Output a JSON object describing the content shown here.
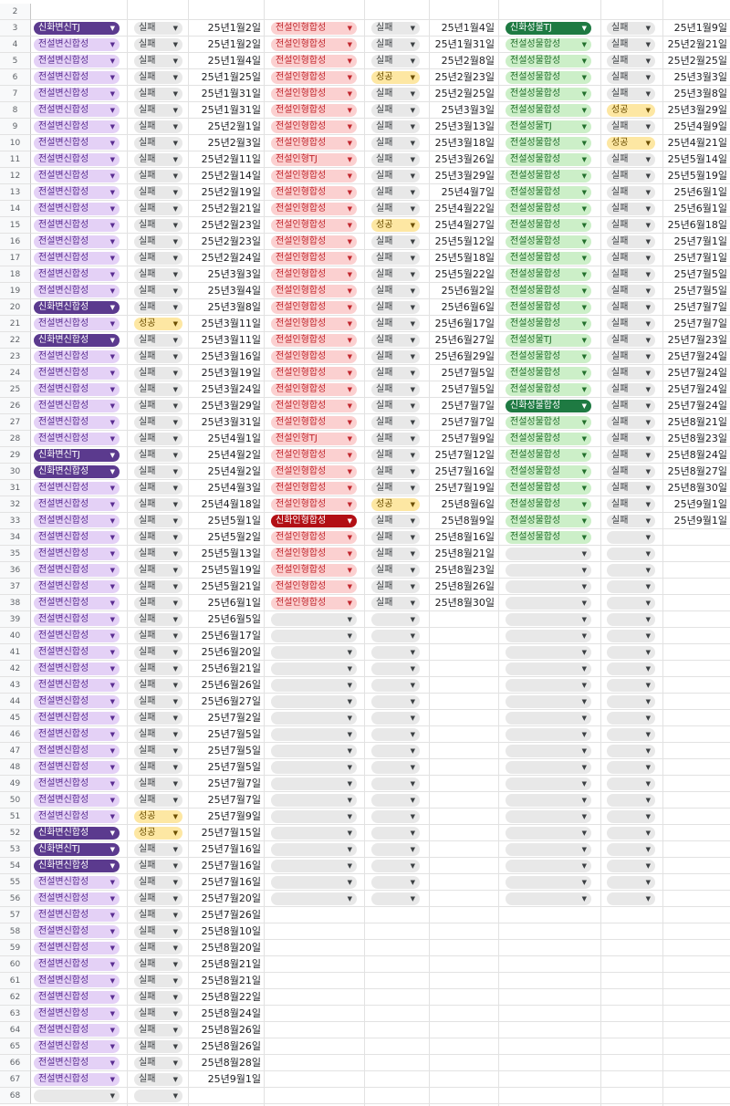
{
  "sheet": {
    "first_row": 2,
    "colors": {
      "purple-light": "#e4d1f6",
      "purple-dark": "#5b3a8e",
      "gray": "#e8e8e8",
      "yellow": "#fde7a3",
      "pink": "#fbd0d0",
      "red-dark": "#b20f15",
      "green-light": "#ccefc8",
      "green-dark": "#1e7a42"
    },
    "col_a": [
      null,
      "신화변신TJ",
      "전설변신합성",
      "전설변신합성",
      "전설변신합성",
      "전설변신합성",
      "전설변신합성",
      "전설변신합성",
      "전설변신합성",
      "전설변신합성",
      "전설변신합성",
      "전설변신합성",
      "전설변신합성",
      "전설변신합성",
      "전설변신합성",
      "전설변신합성",
      "전설변신합성",
      "전설변신합성",
      "신화변신합성",
      "전설변신합성",
      "신화변신합성",
      "전설변신합성",
      "전설변신합성",
      "전설변신합성",
      "전설변신합성",
      "전설변신합성",
      "전설변신합성",
      "신화변신TJ",
      "신화변신합성",
      "전설변신합성",
      "전설변신합성",
      "전설변신합성",
      "전설변신합성",
      "전설변신합성",
      "전설변신합성",
      "전설변신합성",
      "전설변신합성",
      "전설변신합성",
      "전설변신합성",
      "전설변신합성",
      "전설변신합성",
      "전설변신합성",
      "전설변신합성",
      "전설변신합성",
      "전설변신합성",
      "전설변신합성",
      "전설변신합성",
      "전설변신합성",
      "전설변신합성",
      "전설변신합성",
      "신화변신합성",
      "신화변신TJ",
      "신화변신합성",
      "전설변신합성",
      "전설변신합성",
      "전설변신합성",
      "전설변신합성",
      "전설변신합성",
      "전설변신합성",
      "전설변신합성",
      "전설변신합성",
      "전설변신합성",
      "전설변신합성",
      "전설변신합성",
      "전설변신합성",
      "전설변신합성",
      ""
    ],
    "col_b": [
      null,
      "실패",
      "실패",
      "실패",
      "실패",
      "실패",
      "실패",
      "실패",
      "실패",
      "실패",
      "실패",
      "실패",
      "실패",
      "실패",
      "실패",
      "실패",
      "실패",
      "실패",
      "실패",
      "성공",
      "실패",
      "실패",
      "실패",
      "실패",
      "실패",
      "실패",
      "실패",
      "실패",
      "실패",
      "실패",
      "실패",
      "실패",
      "실패",
      "실패",
      "실패",
      "실패",
      "실패",
      "실패",
      "실패",
      "실패",
      "실패",
      "실패",
      "실패",
      "실패",
      "실패",
      "실패",
      "실패",
      "실패",
      "실패",
      "성공",
      "성공",
      "실패",
      "실패",
      "실패",
      "실패",
      "실패",
      "실패",
      "실패",
      "실패",
      "실패",
      "실패",
      "실패",
      "실패",
      "실패",
      "실패",
      "실패",
      ""
    ],
    "col_c": [
      null,
      "25년1월2일",
      "25년1월2일",
      "25년1월4일",
      "25년1월25일",
      "25년1월31일",
      "25년1월31일",
      "25년2월1일",
      "25년2월3일",
      "25년2월11일",
      "25년2월14일",
      "25년2월19일",
      "25년2월21일",
      "25년2월23일",
      "25년2월23일",
      "25년2월24일",
      "25년3월3일",
      "25년3월4일",
      "25년3월8일",
      "25년3월11일",
      "25년3월11일",
      "25년3월16일",
      "25년3월19일",
      "25년3월24일",
      "25년3월29일",
      "25년3월31일",
      "25년4월1일",
      "25년4월2일",
      "25년4월2일",
      "25년4월3일",
      "25년4월18일",
      "25년5월1일",
      "25년5월2일",
      "25년5월13일",
      "25년5월19일",
      "25년5월21일",
      "25년6월1일",
      "25년6월5일",
      "25년6월17일",
      "25년6월20일",
      "25년6월21일",
      "25년6월26일",
      "25년6월27일",
      "25년7월2일",
      "25년7월5일",
      "25년7월5일",
      "25년7월5일",
      "25년7월7일",
      "25년7월7일",
      "25년7월9일",
      "25년7월15일",
      "25년7월16일",
      "25년7월16일",
      "25년7월16일",
      "25년7월20일",
      "25년7월26일",
      "25년8월10일",
      "25년8월20일",
      "25년8월21일",
      "25년8월21일",
      "25년8월22일",
      "25년8월24일",
      "25년8월26일",
      "25년8월26일",
      "25년8월28일",
      "25년9월1일",
      null
    ],
    "col_d": [
      null,
      "전설인형합성",
      "전설인형합성",
      "전설인형합성",
      "전설인형합성",
      "전설인형합성",
      "전설인형합성",
      "전설인형합성",
      "전설인형합성",
      "전설인형TJ",
      "전설인형합성",
      "전설인형합성",
      "전설인형합성",
      "전설인형합성",
      "전설인형합성",
      "전설인형합성",
      "전설인형합성",
      "전설인형합성",
      "전설인형합성",
      "전설인형합성",
      "전설인형합성",
      "전설인형합성",
      "전설인형합성",
      "전설인형합성",
      "전설인형합성",
      "전설인형합성",
      "전설인형TJ",
      "전설인형합성",
      "전설인형합성",
      "전설인형합성",
      "전설인형합성",
      "신화인형합성",
      "전설인형합성",
      "전설인형합성",
      "전설인형합성",
      "전설인형합성",
      "전설인형합성",
      "",
      "",
      "",
      "",
      "",
      "",
      "",
      "",
      "",
      "",
      "",
      "",
      "",
      "",
      "",
      "",
      "",
      "",
      null,
      null,
      null,
      null,
      null,
      null,
      null,
      null,
      null,
      null,
      null,
      null
    ],
    "col_e": [
      null,
      "실패",
      "실패",
      "실패",
      "성공",
      "실패",
      "실패",
      "실패",
      "실패",
      "실패",
      "실패",
      "실패",
      "실패",
      "성공",
      "실패",
      "실패",
      "실패",
      "실패",
      "실패",
      "실패",
      "실패",
      "실패",
      "실패",
      "실패",
      "실패",
      "실패",
      "실패",
      "실패",
      "실패",
      "실패",
      "성공",
      "실패",
      "실패",
      "실패",
      "실패",
      "실패",
      "실패",
      "",
      "",
      "",
      "",
      "",
      "",
      "",
      "",
      "",
      "",
      "",
      "",
      "",
      "",
      "",
      "",
      "",
      "",
      null,
      null,
      null,
      null,
      null,
      null,
      null,
      null,
      null,
      null,
      null,
      null
    ],
    "col_f": [
      null,
      "25년1월4일",
      "25년1월31일",
      "25년2월8일",
      "25년2월23일",
      "25년2월25일",
      "25년3월3일",
      "25년3월13일",
      "25년3월18일",
      "25년3월26일",
      "25년3월29일",
      "25년4월7일",
      "25년4월22일",
      "25년4월27일",
      "25년5월12일",
      "25년5월18일",
      "25년5월22일",
      "25년6월2일",
      "25년6월6일",
      "25년6월17일",
      "25년6월27일",
      "25년6월29일",
      "25년7월5일",
      "25년7월5일",
      "25년7월7일",
      "25년7월7일",
      "25년7월9일",
      "25년7월12일",
      "25년7월16일",
      "25년7월19일",
      "25년8월6일",
      "25년8월9일",
      "25년8월16일",
      "25년8월21일",
      "25년8월23일",
      "25년8월26일",
      "25년8월30일",
      null,
      null,
      null,
      null,
      null,
      null,
      null,
      null,
      null,
      null,
      null,
      null,
      null,
      null,
      null,
      null,
      null,
      null,
      null,
      null,
      null,
      null,
      null,
      null,
      null,
      null,
      null,
      null,
      null,
      null
    ],
    "col_g": [
      null,
      "신화성물TJ",
      "전설성물합성",
      "전설성물합성",
      "전설성물합성",
      "전설성물합성",
      "전설성물합성",
      "전설성물TJ",
      "전설성물합성",
      "전설성물합성",
      "전설성물합성",
      "전설성물합성",
      "전설성물합성",
      "전설성물합성",
      "전설성물합성",
      "전설성물합성",
      "전설성물합성",
      "전설성물합성",
      "전설성물합성",
      "전설성물합성",
      "전설성물TJ",
      "전설성물합성",
      "전설성물합성",
      "전설성물합성",
      "신화성물합성",
      "전설성물합성",
      "전설성물합성",
      "전설성물합성",
      "전설성물합성",
      "전설성물합성",
      "전설성물합성",
      "전설성물합성",
      "전설성물합성",
      "",
      "",
      "",
      "",
      "",
      "",
      "",
      "",
      "",
      "",
      "",
      "",
      "",
      "",
      "",
      "",
      "",
      "",
      "",
      "",
      "",
      "",
      null,
      null,
      null,
      null,
      null,
      null,
      null,
      null,
      null,
      null,
      null,
      null
    ],
    "col_h": [
      null,
      "실패",
      "실패",
      "실패",
      "실패",
      "실패",
      "성공",
      "실패",
      "성공",
      "실패",
      "실패",
      "실패",
      "실패",
      "실패",
      "실패",
      "실패",
      "실패",
      "실패",
      "실패",
      "실패",
      "실패",
      "실패",
      "실패",
      "실패",
      "실패",
      "실패",
      "실패",
      "실패",
      "실패",
      "실패",
      "실패",
      "실패",
      "",
      "",
      "",
      "",
      "",
      "",
      "",
      "",
      "",
      "",
      "",
      "",
      "",
      "",
      "",
      "",
      "",
      "",
      "",
      "",
      "",
      "",
      "",
      null,
      null,
      null,
      null,
      null,
      null,
      null,
      null,
      null,
      null,
      null,
      null
    ],
    "col_i": [
      null,
      "25년1월9일",
      "25년2월21일",
      "25년2월25일",
      "25년3월3일",
      "25년3월8일",
      "25년3월29일",
      "25년4월9일",
      "25년4월21일",
      "25년5월14일",
      "25년5월19일",
      "25년6월1일",
      "25년6월1일",
      "25년6월18일",
      "25년7월1일",
      "25년7월1일",
      "25년7월5일",
      "25년7월5일",
      "25년7월7일",
      "25년7월7일",
      "25년7월23일",
      "25년7월24일",
      "25년7월24일",
      "25년7월24일",
      "25년7월24일",
      "25년8월21일",
      "25년8월23일",
      "25년8월24일",
      "25년8월27일",
      "25년8월30일",
      "25년9월1일",
      "25년9월1일",
      null,
      null,
      null,
      null,
      null,
      null,
      null,
      null,
      null,
      null,
      null,
      null,
      null,
      null,
      null,
      null,
      null,
      null,
      null,
      null,
      null,
      null,
      null,
      null,
      null,
      null,
      null,
      null,
      null,
      null,
      null,
      null,
      null,
      null,
      null
    ]
  }
}
